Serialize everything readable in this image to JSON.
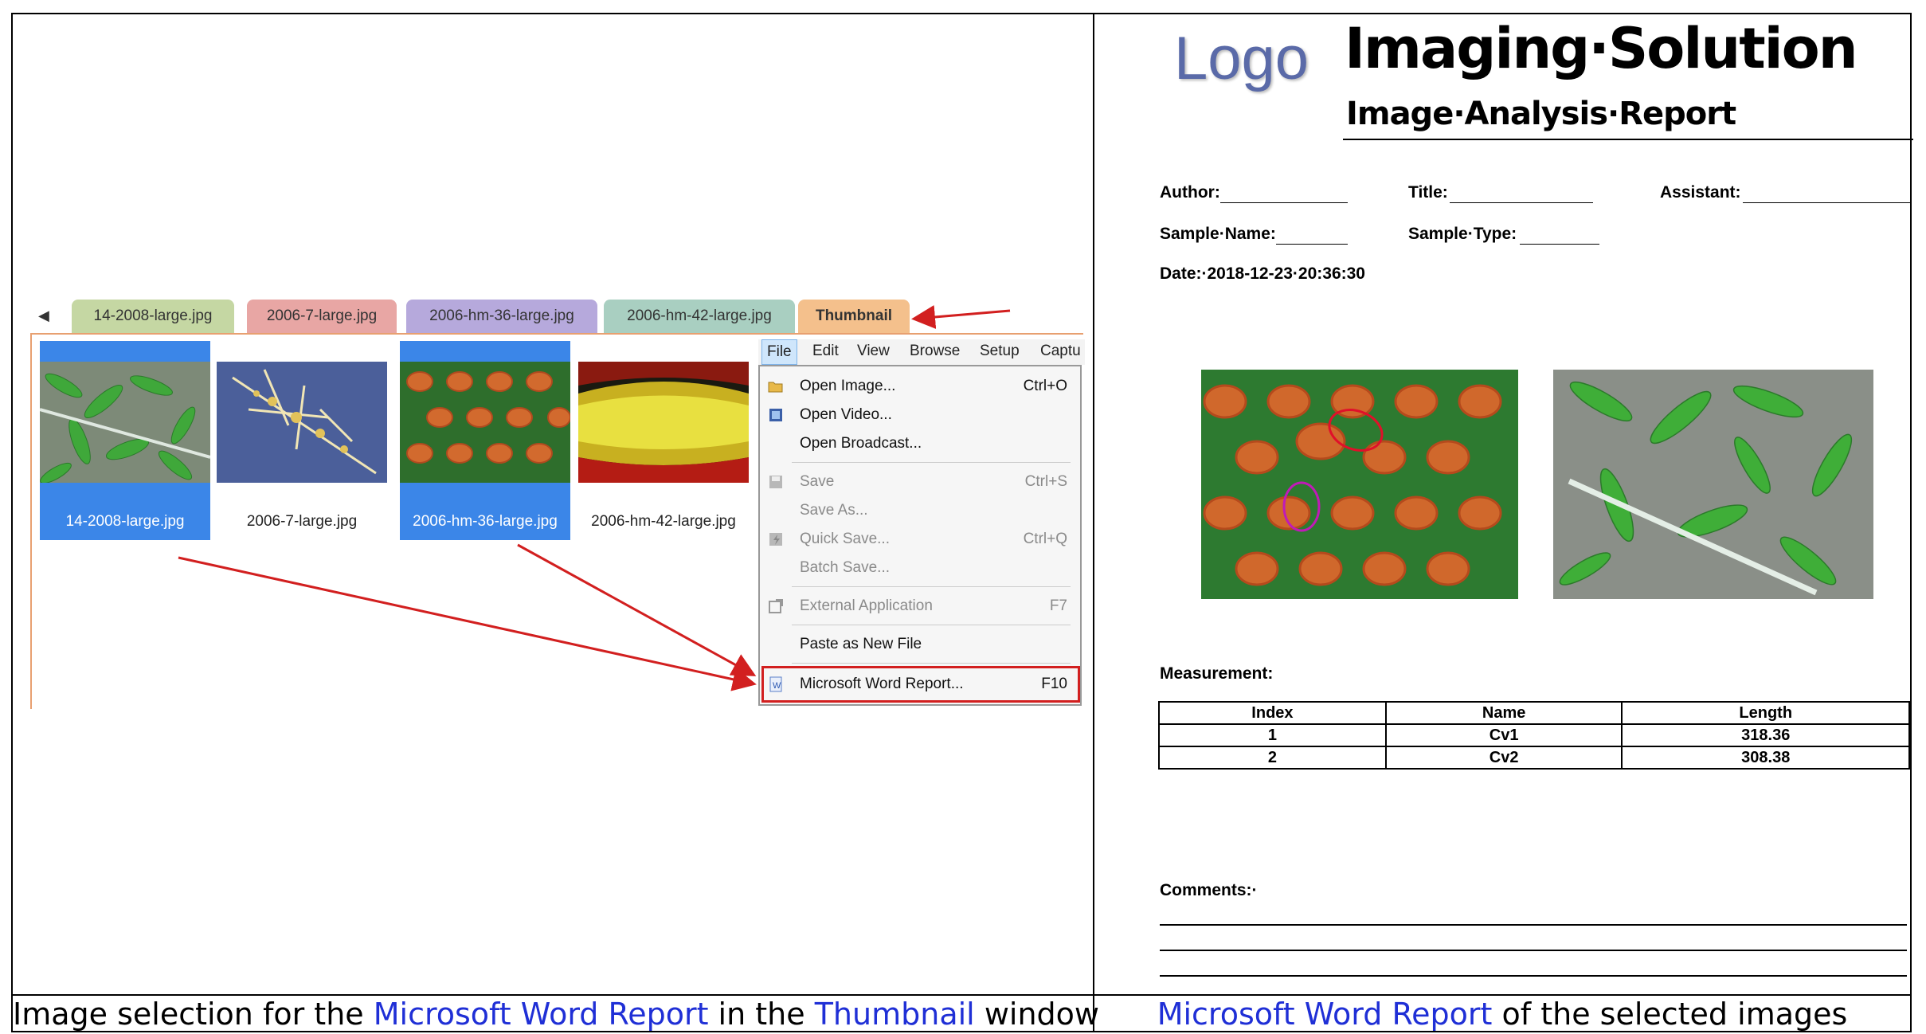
{
  "left_panel": {
    "tabs": [
      {
        "label": "14-2008-large.jpg",
        "color": "#c5d7a3"
      },
      {
        "label": "2006-7-large.jpg",
        "color": "#e8a6a4"
      },
      {
        "label": "2006-hm-36-large.jpg",
        "color": "#b6a9dc"
      },
      {
        "label": "2006-hm-42-large.jpg",
        "color": "#a9cfc1"
      },
      {
        "label": "Thumbnail",
        "color": "#f4c08c"
      }
    ],
    "thumbnails": [
      {
        "label": "14-2008-large.jpg",
        "selected": true
      },
      {
        "label": "2006-7-large.jpg",
        "selected": false
      },
      {
        "label": "2006-hm-36-large.jpg",
        "selected": true
      },
      {
        "label": "2006-hm-42-large.jpg",
        "selected": false
      }
    ],
    "menubar": [
      "File",
      "Edit",
      "View",
      "Browse",
      "Setup",
      "Captu"
    ],
    "file_menu": [
      {
        "label": "Open Image...",
        "shortcut": "Ctrl+O",
        "icon": "folder-open-icon",
        "enabled": true
      },
      {
        "label": "Open Video...",
        "shortcut": "",
        "icon": "film-icon",
        "enabled": true
      },
      {
        "label": "Open Broadcast...",
        "shortcut": "",
        "icon": "",
        "enabled": true
      },
      {
        "label": "Save",
        "shortcut": "Ctrl+S",
        "icon": "save-icon",
        "enabled": false
      },
      {
        "label": "Save As...",
        "shortcut": "",
        "icon": "",
        "enabled": false
      },
      {
        "label": "Quick Save...",
        "shortcut": "Ctrl+Q",
        "icon": "quick-save-icon",
        "enabled": false
      },
      {
        "label": "Batch Save...",
        "shortcut": "",
        "icon": "",
        "enabled": false
      },
      {
        "label": "External Application",
        "shortcut": "F7",
        "icon": "external-app-icon",
        "enabled": false
      },
      {
        "label": "Paste as New File",
        "shortcut": "",
        "icon": "",
        "enabled": true
      },
      {
        "label": "Microsoft Word Report...",
        "shortcut": "F10",
        "icon": "word-icon",
        "enabled": true
      }
    ]
  },
  "captions": {
    "left": {
      "pre": "Image selection for the ",
      "hl1": "Microsoft Word Report",
      "mid": " in the ",
      "hl2": "Thumbnail",
      "post": " window"
    },
    "right": {
      "hl": "Microsoft Word Report",
      "post": " of the selected images"
    }
  },
  "report": {
    "logo": "Logo",
    "title": "Imaging·Solution",
    "subtitle": "Image·Analysis·Report",
    "author_label": "Author:",
    "title_label": "Title:",
    "assistant_label": "Assistant:",
    "sample_name_label": "Sample·Name:",
    "sample_type_label": "Sample·Type:",
    "date_label": "Date:·2018-12-23·20:36:30",
    "measurement_label": "Measurement:",
    "comments_label": "Comments:·",
    "table": {
      "headers": [
        "Index",
        "Name",
        "Length"
      ],
      "rows": [
        [
          "1",
          "Cv1",
          "318.36"
        ],
        [
          "2",
          "Cv2",
          "308.38"
        ]
      ]
    }
  },
  "colors": {
    "accent_blue": "#1f2fd6",
    "highlight_red": "#d21f1f",
    "selection_blue": "#3b86e8"
  }
}
